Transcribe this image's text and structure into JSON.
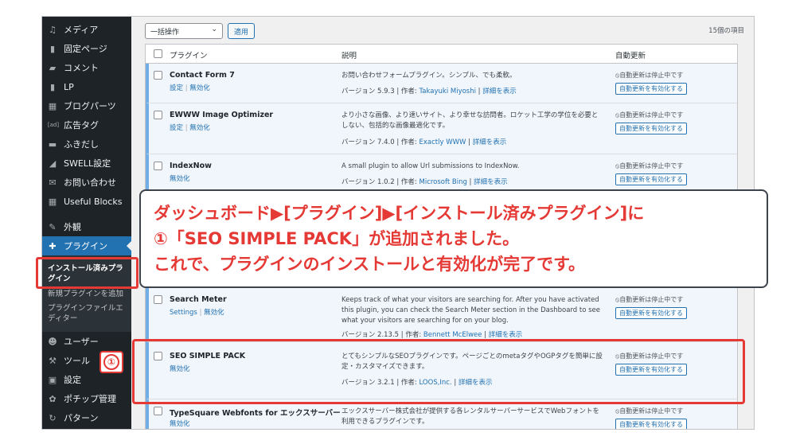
{
  "sidebar": {
    "items": [
      {
        "label": "メディア",
        "icon": "media-icon"
      },
      {
        "label": "固定ページ",
        "icon": "page-icon"
      },
      {
        "label": "コメント",
        "icon": "comment-icon"
      },
      {
        "label": "LP",
        "icon": "page-icon"
      },
      {
        "label": "ブログパーツ",
        "icon": "blogparts-icon"
      },
      {
        "label": "広告タグ",
        "icon": "ad-icon",
        "icon_text": "[ad]"
      },
      {
        "label": "ふきだし",
        "icon": "balloon-icon"
      },
      {
        "label": "SWELL設定",
        "icon": "swell-icon"
      },
      {
        "label": "お問い合わせ",
        "icon": "mail-icon"
      },
      {
        "label": "Useful Blocks",
        "icon": "blocks-icon"
      },
      {
        "label": "外観",
        "icon": "appearance-icon"
      },
      {
        "label": "プラグイン",
        "icon": "plugin-icon"
      },
      {
        "label": "ユーザー",
        "icon": "user-icon"
      },
      {
        "label": "ツール",
        "icon": "tool-icon"
      },
      {
        "label": "設定",
        "icon": "settings-icon"
      },
      {
        "label": "ポチップ管理",
        "icon": "pochipp-icon"
      },
      {
        "label": "パターン",
        "icon": "pattern-icon"
      }
    ],
    "submenu": [
      "インストール済みプラグイン",
      "新規プラグインを追加",
      "プラグインファイルエディター"
    ]
  },
  "toolbar": {
    "bulk_action": "一括操作",
    "apply": "適用",
    "count": "15個の項目"
  },
  "table": {
    "headers": {
      "plugin": "プラグイン",
      "description": "説明",
      "auto_update": "自動更新"
    },
    "rows": [
      {
        "name": "Contact Form 7",
        "actions": [
          "設定",
          "無効化"
        ],
        "description": "お問い合わせフォームプラグイン。シンプル、でも柔軟。",
        "version_text": "バージョン 5.9.3 | 作者:",
        "author": "Takayuki Miyoshi",
        "details": "詳細を表示",
        "auto_status": "自動更新は停止中です",
        "auto_button": "自動更新を有効化する"
      },
      {
        "name": "EWWW Image Optimizer",
        "actions": [
          "設定",
          "無効化"
        ],
        "description": "より小さな画像、より速いサイト、より幸せな訪問者。ロケット工学の学位を必要としない、包括的な画像最適化です。",
        "version_text": "バージョン 7.4.0 | 作者:",
        "author": "Exactly WWW",
        "details": "詳細を表示",
        "auto_status": "自動更新は停止中です",
        "auto_button": "自動更新を有効化する"
      },
      {
        "name": "IndexNow",
        "actions": [
          "無効化"
        ],
        "description": "A small plugin to allow Url submissions to IndexNow.",
        "version_text": "バージョン 1.0.2 | 作者:",
        "author": "Microsoft Bing",
        "details": "詳細を表示",
        "auto_status": "自動更新は停止中です",
        "auto_button": "自動更新を有効化する"
      },
      {
        "name": "Search Meter",
        "actions": [
          "Settings",
          "無効化"
        ],
        "description": "Keeps track of what your visitors are searching for. After you have activated this plugin, you can check the Search Meter section in the Dashboard to see what your visitors are searching for on your blog.",
        "version_text": "バージョン 2.13.5 | 作者:",
        "author": "Bennett McElwee",
        "details": "詳細を表示",
        "auto_status": "自動更新は停止中です",
        "auto_button": "自動更新を有効化する"
      },
      {
        "name": "SEO SIMPLE PACK",
        "actions": [
          "無効化"
        ],
        "description": "とてもシンプルなSEOプラグインです。ページごとのmetaタグやOGPタグを簡単に設定・カスタマイズできます。",
        "version_text": "バージョン 3.2.1 | 作者:",
        "author": "LOOS,Inc.",
        "details": "詳細を表示",
        "auto_status": "自動更新は停止中です",
        "auto_button": "自動更新を有効化する"
      },
      {
        "name": "TypeSquare Webfonts for エックスサーバー",
        "actions": [
          "無効化"
        ],
        "description": "エックスサーバー株式会社が提供する各レンタルサーバーサービスでWebフォントを利用できるプラグインです。",
        "version_text": "",
        "author": "",
        "details": "",
        "auto_status": "自動更新は停止中です",
        "auto_button": "自動更新を有効化する"
      }
    ]
  },
  "callout": {
    "line1": "ダッシュボード▶[プラグイン]▶[インストール済みプラグイン]に",
    "line2": "①「SEO SIMPLE PACK」が追加されました。",
    "line3": "これで、プラグインのインストールと有効化が完了です。"
  },
  "badge": "①",
  "colors": {
    "accent_red": "#e53935",
    "wp_blue": "#2271b1",
    "sidebar_bg": "#1d2327"
  }
}
